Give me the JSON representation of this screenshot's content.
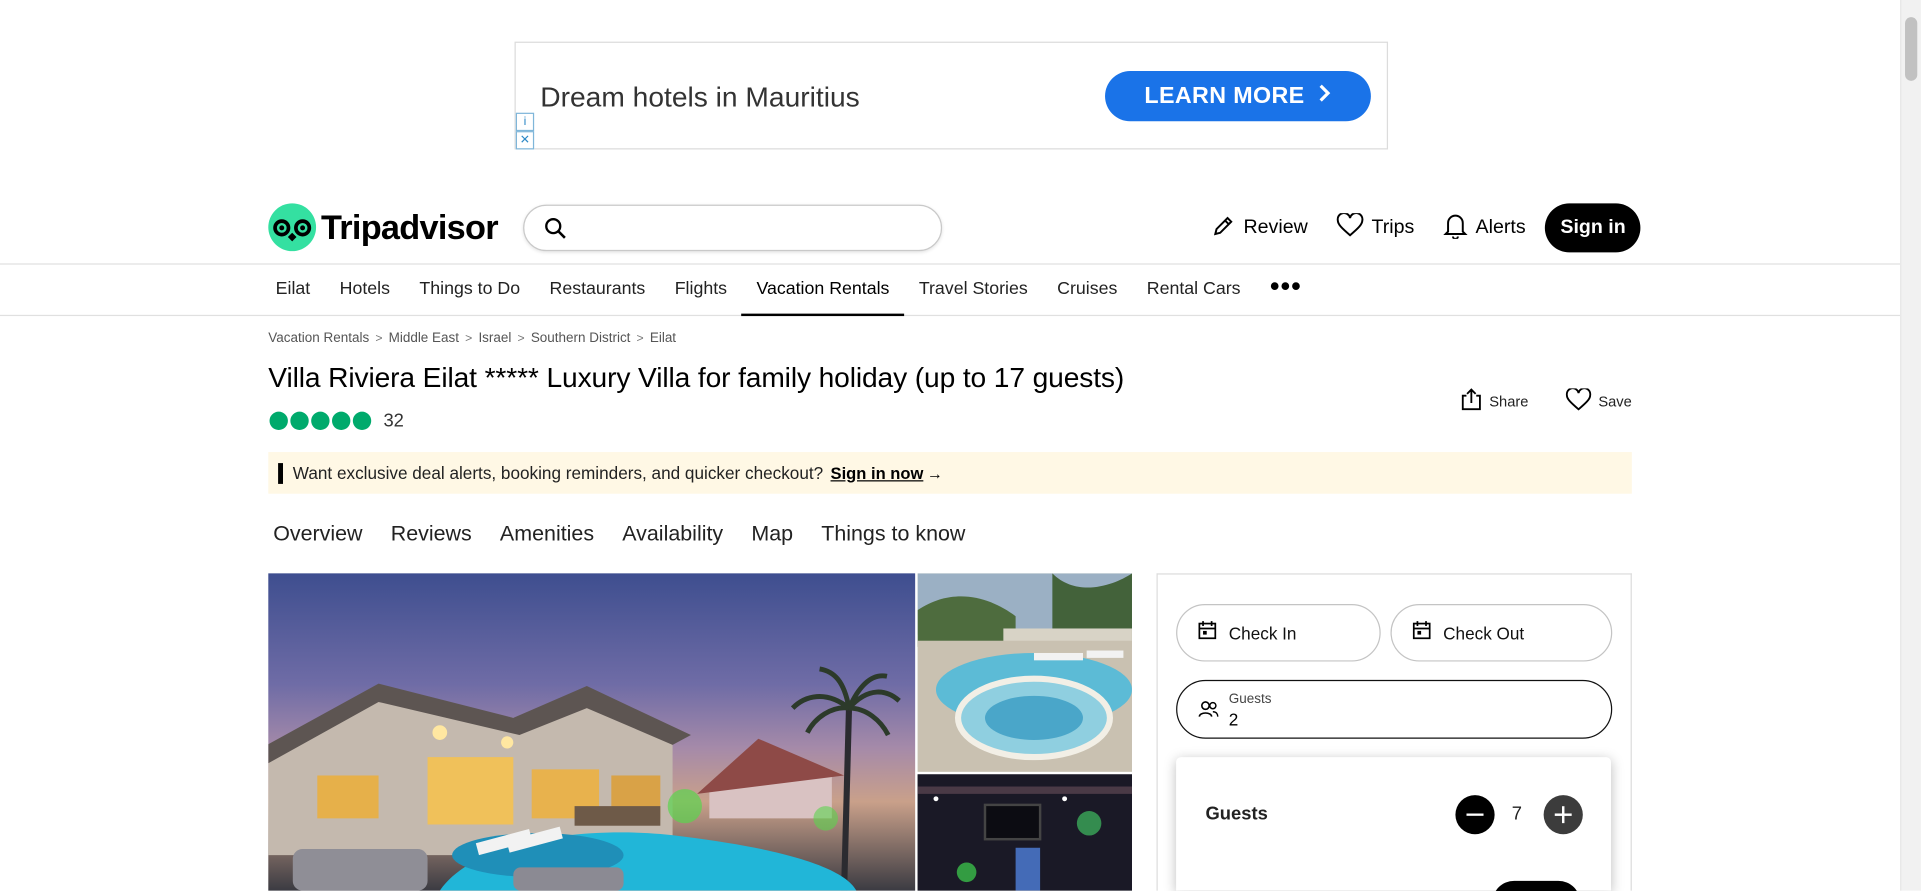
{
  "ad": {
    "text": "Dream hotels in Mauritius",
    "cta": "LEARN MORE",
    "info_icon": "info-icon",
    "close_icon": "close-icon"
  },
  "header": {
    "logo_text": "Tripadvisor",
    "search_placeholder": "",
    "nav": [
      {
        "label": "Review",
        "icon": "pencil-icon"
      },
      {
        "label": "Trips",
        "icon": "heart-icon"
      },
      {
        "label": "Alerts",
        "icon": "bell-icon"
      }
    ],
    "signin_label": "Sign in"
  },
  "subnav": {
    "tabs": [
      "Eilat",
      "Hotels",
      "Things to Do",
      "Restaurants",
      "Flights",
      "Vacation Rentals",
      "Travel Stories",
      "Cruises",
      "Rental Cars"
    ],
    "active_tab": "Vacation Rentals",
    "more_label": "•••"
  },
  "breadcrumb": [
    "Vacation Rentals",
    "Middle East",
    "Israel",
    "Southern District",
    "Eilat"
  ],
  "listing": {
    "title": "Villa Riviera Eilat ***** Luxury Villa for family holiday (up to 17 guests)",
    "rating": 5,
    "review_count": "32",
    "share_label": "Share",
    "save_label": "Save"
  },
  "banner": {
    "text": "Want exclusive deal alerts, booking reminders, and quicker checkout?",
    "link": "Sign in now",
    "arrow": "→"
  },
  "page_tabs": [
    "Overview",
    "Reviews",
    "Amenities",
    "Availability",
    "Map",
    "Things to know"
  ],
  "booking": {
    "check_in_label": "Check In",
    "check_out_label": "Check Out",
    "guests_label": "Guests",
    "guests_value": "2",
    "popover": {
      "title": "Guests",
      "count": "7",
      "minus": "−",
      "plus": "+"
    }
  },
  "colors": {
    "brand_green": "#34e0a1",
    "rating_green": "#00aa6c",
    "banner_bg": "#fff8e5",
    "ad_button": "#1a73e8"
  }
}
